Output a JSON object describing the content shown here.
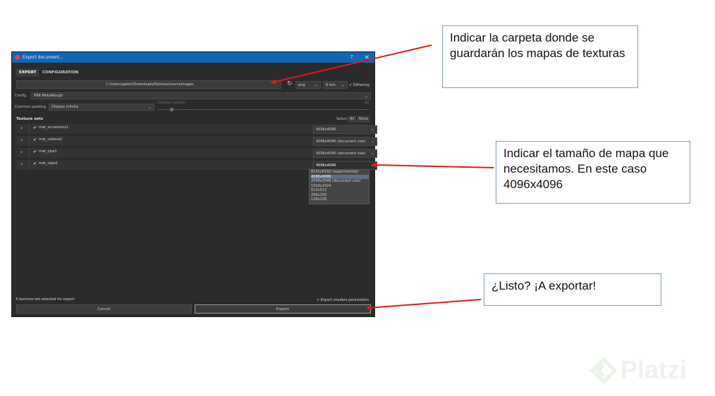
{
  "window": {
    "title": "Export document...",
    "help": "?",
    "close": "✕",
    "tabs": [
      "EXPORT",
      "CONFIGURATION"
    ],
    "path": "C:/Users/gabsh/Downloads/Pjolotes/sourceimages",
    "format": "png",
    "bits": "8 bits",
    "dithering": "Dithering",
    "config_label": "Config",
    "config_value": "PBR MetalRough",
    "padding_label": "Common padding",
    "padding_value": "Dilation infinite",
    "dilation_label": "Dilation (pixels)",
    "dilation_value": "16",
    "texture_sets_label": "Texture sets",
    "select_label": "Select",
    "select_all": "All",
    "select_none": "None",
    "texture_sets": [
      {
        "name": "mat_accesorios1",
        "size": "4096x4096"
      },
      {
        "name": "mat_cabeza1",
        "size": "4096x4096 (document size)"
      },
      {
        "name": "mat_ojos1",
        "size": "4096x4096 (document size)"
      },
      {
        "name": "mat_ropa1",
        "size": "4096x4096"
      }
    ],
    "size_options": [
      "8192x8192 (experimental)",
      "4096x4096",
      "2048x2048 (document size)",
      "1024x1024",
      "512x512",
      "256x256",
      "128x128"
    ],
    "status": "4 textures set selected for export",
    "export_shaders": "Export shaders parameters",
    "cancel": "Cancel",
    "export": "Export"
  },
  "annotations": {
    "folder": "Indicar la carpeta donde se guardarán los mapas de texturas",
    "size": "Indicar el tamaño de mapa que necesitamos. En este caso 4096x4096",
    "export": "¿Listo? ¡A exportar!"
  },
  "watermark": "Platzi",
  "colors": {
    "accent": "#1266b4",
    "arrow": "#e01b1b",
    "annotation_border": "#7f9ec4"
  }
}
